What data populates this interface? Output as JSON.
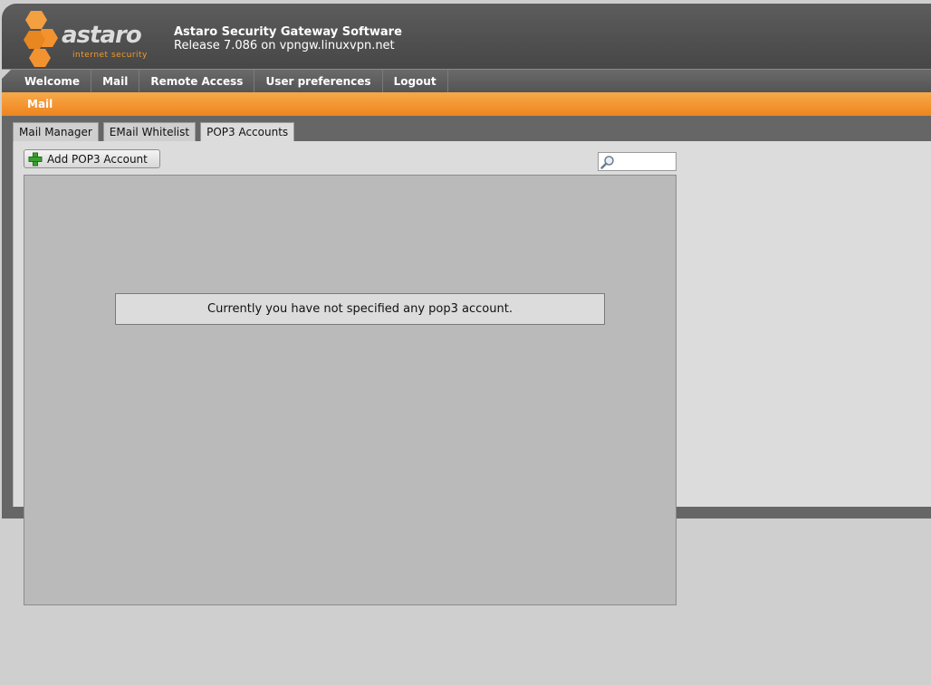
{
  "header": {
    "logo_word": "astaro",
    "logo_sub": "internet security",
    "title": "Astaro Security Gateway Software",
    "release": "Release 7.086 on vpngw.linuxvpn.net"
  },
  "nav": {
    "items": [
      "Welcome",
      "Mail",
      "Remote Access",
      "User preferences",
      "Logout"
    ]
  },
  "section": {
    "title": "Mail"
  },
  "tabs": [
    {
      "label": "Mail Manager",
      "active": false
    },
    {
      "label": "EMail Whitelist",
      "active": false
    },
    {
      "label": "POP3 Accounts",
      "active": true
    }
  ],
  "toolbar": {
    "add_label": "Add POP3 Account"
  },
  "search": {
    "value": "",
    "placeholder": ""
  },
  "list": {
    "empty_message": "Currently you have not specified any pop3 account."
  },
  "colors": {
    "accent": "#f39330",
    "header": "#555555",
    "frame": "#666666"
  }
}
